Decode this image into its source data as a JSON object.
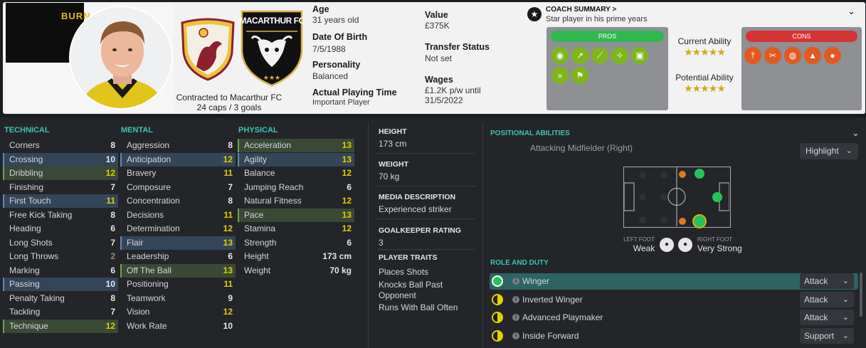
{
  "player": {
    "surname_partial": "BURN",
    "contract_text": "Contracted to Macarthur FC",
    "caps_goals": "24 caps / 3 goals",
    "club_short": "MACARTHUR FC"
  },
  "bio": {
    "age_label": "Age",
    "age_value": "31 years old",
    "dob_label": "Date Of Birth",
    "dob_value": "7/5/1988",
    "personality_label": "Personality",
    "personality_value": "Balanced",
    "apt_label": "Actual Playing Time",
    "apt_value": "Important Player",
    "value_label": "Value",
    "value_value": "£375K",
    "transfer_label": "Transfer Status",
    "transfer_value": "Not set",
    "wages_label": "Wages",
    "wages_value": "£1.2K p/w until",
    "wages_until": "31/5/2022"
  },
  "coach": {
    "title": "COACH SUMMARY >",
    "summary": "Star player in his prime years",
    "pros_label": "PROS",
    "cons_label": "CONS",
    "current_ability_label": "Current Ability",
    "potential_ability_label": "Potential Ability",
    "current_ability_stars": 5,
    "potential_ability_stars": 5,
    "pros_icons": [
      "heading-icon",
      "crossing-icon",
      "dribbling-icon",
      "flair-icon",
      "set-pieces-icon",
      "pace-icon",
      "corners-icon"
    ],
    "cons_icons": [
      "jumping-icon",
      "tackling-icon",
      "marking-icon",
      "bravery-icon",
      "strength-icon"
    ],
    "pros_color": "#2fb84f",
    "cons_color": "#d63434",
    "pro_icon_color": "#7fb61c",
    "con_icon_color": "#e4581f"
  },
  "technical": {
    "header": "TECHNICAL",
    "rows": [
      {
        "name": "Corners",
        "value": "8",
        "hl": "none",
        "tone": "w"
      },
      {
        "name": "Crossing",
        "value": "10",
        "hl": "blue",
        "tone": "w"
      },
      {
        "name": "Dribbling",
        "value": "12",
        "hl": "green",
        "tone": "y"
      },
      {
        "name": "Finishing",
        "value": "7",
        "hl": "none",
        "tone": "w"
      },
      {
        "name": "First Touch",
        "value": "11",
        "hl": "blue",
        "tone": "y"
      },
      {
        "name": "Free Kick Taking",
        "value": "8",
        "hl": "none",
        "tone": "w"
      },
      {
        "name": "Heading",
        "value": "6",
        "hl": "none",
        "tone": "w"
      },
      {
        "name": "Long Shots",
        "value": "7",
        "hl": "none",
        "tone": "w"
      },
      {
        "name": "Long Throws",
        "value": "2",
        "hl": "none",
        "tone": "g"
      },
      {
        "name": "Marking",
        "value": "6",
        "hl": "none",
        "tone": "w"
      },
      {
        "name": "Passing",
        "value": "10",
        "hl": "blue",
        "tone": "w"
      },
      {
        "name": "Penalty Taking",
        "value": "8",
        "hl": "none",
        "tone": "w"
      },
      {
        "name": "Tackling",
        "value": "7",
        "hl": "none",
        "tone": "w"
      },
      {
        "name": "Technique",
        "value": "12",
        "hl": "green",
        "tone": "y"
      }
    ]
  },
  "mental": {
    "header": "MENTAL",
    "rows": [
      {
        "name": "Aggression",
        "value": "8",
        "hl": "none",
        "tone": "w"
      },
      {
        "name": "Anticipation",
        "value": "12",
        "hl": "blue",
        "tone": "y"
      },
      {
        "name": "Bravery",
        "value": "11",
        "hl": "none",
        "tone": "y"
      },
      {
        "name": "Composure",
        "value": "7",
        "hl": "none",
        "tone": "w"
      },
      {
        "name": "Concentration",
        "value": "8",
        "hl": "none",
        "tone": "w"
      },
      {
        "name": "Decisions",
        "value": "11",
        "hl": "none",
        "tone": "y"
      },
      {
        "name": "Determination",
        "value": "12",
        "hl": "none",
        "tone": "y"
      },
      {
        "name": "Flair",
        "value": "13",
        "hl": "blue",
        "tone": "y"
      },
      {
        "name": "Leadership",
        "value": "6",
        "hl": "none",
        "tone": "w"
      },
      {
        "name": "Off The Ball",
        "value": "13",
        "hl": "green",
        "tone": "y"
      },
      {
        "name": "Positioning",
        "value": "11",
        "hl": "none",
        "tone": "y"
      },
      {
        "name": "Teamwork",
        "value": "9",
        "hl": "none",
        "tone": "w"
      },
      {
        "name": "Vision",
        "value": "12",
        "hl": "none",
        "tone": "y"
      },
      {
        "name": "Work Rate",
        "value": "10",
        "hl": "none",
        "tone": "w"
      }
    ]
  },
  "physical": {
    "header": "PHYSICAL",
    "rows": [
      {
        "name": "Acceleration",
        "value": "13",
        "hl": "green",
        "tone": "y"
      },
      {
        "name": "Agility",
        "value": "13",
        "hl": "blue",
        "tone": "y"
      },
      {
        "name": "Balance",
        "value": "12",
        "hl": "none",
        "tone": "y"
      },
      {
        "name": "Jumping Reach",
        "value": "6",
        "hl": "none",
        "tone": "w"
      },
      {
        "name": "Natural Fitness",
        "value": "12",
        "hl": "none",
        "tone": "y"
      },
      {
        "name": "Pace",
        "value": "13",
        "hl": "green",
        "tone": "y"
      },
      {
        "name": "Stamina",
        "value": "12",
        "hl": "none",
        "tone": "y"
      },
      {
        "name": "Strength",
        "value": "6",
        "hl": "none",
        "tone": "w"
      },
      {
        "name": "Height",
        "value": "173 cm",
        "hl": "none",
        "tone": "w"
      },
      {
        "name": "Weight",
        "value": "70 kg",
        "hl": "none",
        "tone": "w"
      }
    ]
  },
  "middle": {
    "height_label": "HEIGHT",
    "height_value": "173 cm",
    "weight_label": "WEIGHT",
    "weight_value": "70 kg",
    "media_label": "MEDIA DESCRIPTION",
    "media_value": "Experienced striker",
    "gk_label": "GOALKEEPER RATING",
    "gk_value": "3",
    "traits_label": "PLAYER TRAITS",
    "traits": [
      "Places Shots",
      "Knocks Ball Past",
      "Opponent",
      "Runs With Ball Often"
    ]
  },
  "positions": {
    "header": "POSITIONAL ABILITIES",
    "position_name": "Attacking Midfielder (Right)",
    "view_select": "Highlight",
    "left_foot_label": "LEFT FOOT",
    "left_foot_value": "Weak",
    "right_foot_label": "RIGHT FOOT",
    "right_foot_value": "Very Strong",
    "natural_color": "#25c45a",
    "accomplished_color": "#e07a1b",
    "unconvincing_color": "#3a3d42"
  },
  "roles": {
    "header": "ROLE AND DUTY",
    "rows": [
      {
        "name": "Winger",
        "duty": "Attack",
        "rating": "full"
      },
      {
        "name": "Inverted Winger",
        "duty": "Attack",
        "rating": "half"
      },
      {
        "name": "Advanced Playmaker",
        "duty": "Attack",
        "rating": "half"
      },
      {
        "name": "Inside Forward",
        "duty": "Support",
        "rating": "half"
      }
    ]
  }
}
